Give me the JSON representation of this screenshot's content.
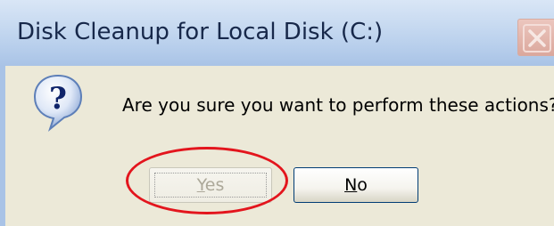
{
  "dialog": {
    "title": "Disk Cleanup for Local Disk (C:)",
    "message": "Are you sure you want to perform these actions?",
    "icon": "question-icon",
    "close_icon": "close-icon",
    "buttons": {
      "yes_prefix": "",
      "yes_mnemonic": "Y",
      "yes_rest": "es",
      "yes_state": "disabled",
      "no_prefix": "",
      "no_mnemonic": "N",
      "no_rest": "o"
    }
  },
  "annotation": {
    "shape": "ellipse",
    "color": "#e3151d",
    "target": "yes-button"
  }
}
